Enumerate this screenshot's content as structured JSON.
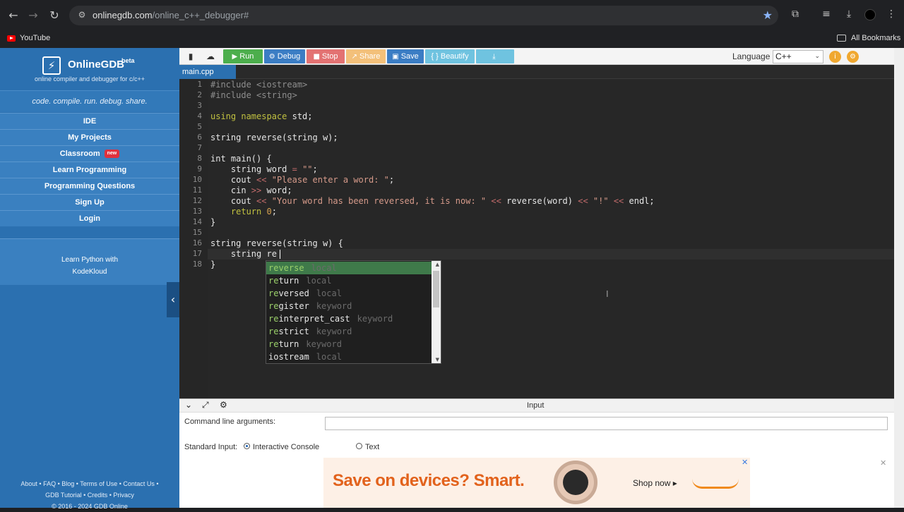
{
  "browser": {
    "url_host": "onlinegdb.com",
    "url_path": "/online_c++_debugger#",
    "bookmark_youtube": "YouTube",
    "all_bookmarks": "All Bookmarks"
  },
  "sidebar": {
    "brand": "OnlineGDB",
    "beta": "beta",
    "tagline": "online compiler and debugger for c/c++",
    "motto": "code. compile. run. debug. share.",
    "items": [
      {
        "label": "IDE"
      },
      {
        "label": "My Projects"
      },
      {
        "label": "Classroom",
        "badge": "new"
      },
      {
        "label": "Learn Programming"
      },
      {
        "label": "Programming Questions"
      },
      {
        "label": "Sign Up"
      },
      {
        "label": "Login"
      }
    ],
    "promo_line1": "Learn Python with",
    "promo_line2": "KodeKloud",
    "footer_line1": "About • FAQ • Blog • Terms of Use • Contact Us •",
    "footer_line2": "GDB Tutorial • Credits • Privacy",
    "footer_line3": "© 2016 - 2024 GDB Online"
  },
  "toolbar": {
    "run": "Run",
    "debug": "Debug",
    "stop": "Stop",
    "share": "Share",
    "save": "Save",
    "beautify": "{ } Beautify",
    "language_label": "Language",
    "language_value": "C++",
    "colors": {
      "run": "#4cae4c",
      "debug": "#3b7dc4",
      "stop": "#e37272",
      "share": "#f3c07a",
      "save": "#3b7dc4",
      "beautify": "#6fc3e0",
      "download": "#6fc3e0"
    }
  },
  "file_tab": "main.cpp",
  "editor": {
    "line_numbers": [
      "1",
      "2",
      "3",
      "4",
      "5",
      "6",
      "7",
      "8",
      "9",
      "10",
      "11",
      "12",
      "13",
      "14",
      "15",
      "16",
      "17",
      "18"
    ],
    "current_line": 17
  },
  "autocomplete": [
    {
      "word": "reverse",
      "type": "local",
      "selected": true
    },
    {
      "word": "return",
      "type": "local"
    },
    {
      "word": "reversed",
      "type": "local"
    },
    {
      "word": "register",
      "type": "keyword"
    },
    {
      "word": "reinterpret_cast",
      "type": "keyword"
    },
    {
      "word": "restrict",
      "type": "keyword"
    },
    {
      "word": "return",
      "type": "keyword"
    },
    {
      "word": "iostream",
      "type": "local"
    }
  ],
  "bottom_panel": {
    "title": "Input",
    "cla_label": "Command line arguments:",
    "stdin_label": "Standard Input:",
    "opt_interactive": "Interactive Console",
    "opt_text": "Text",
    "selected": "Interactive Console"
  },
  "ad": {
    "headline": "Save on devices? Smart.",
    "cta": "Shop now ▸"
  }
}
